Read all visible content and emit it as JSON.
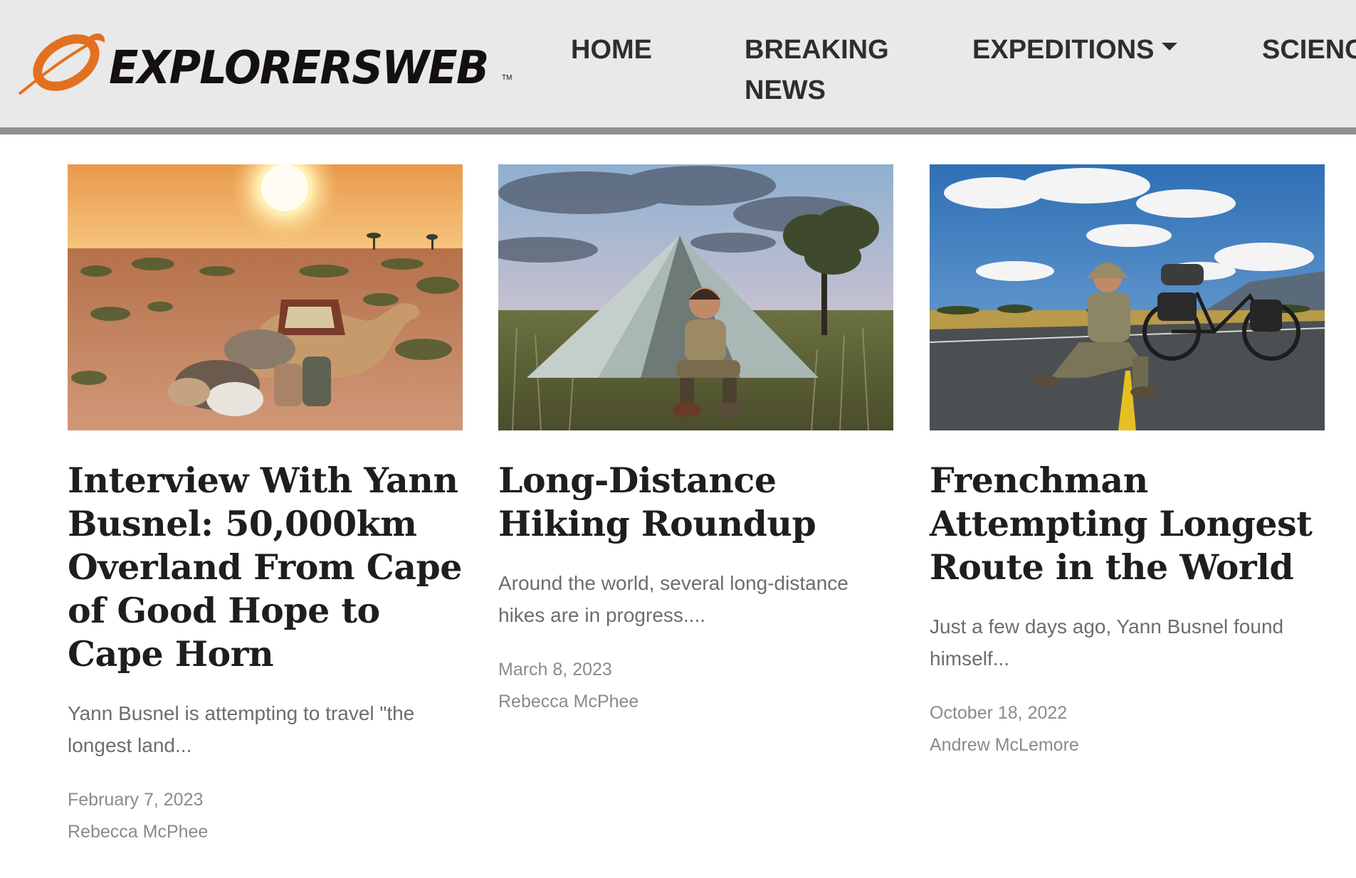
{
  "header": {
    "logo_text": "EXPLORERSWEB",
    "logo_tm": "TM",
    "nav": [
      {
        "label": "HOME"
      },
      {
        "label": "BREAKING NEWS"
      },
      {
        "label": "EXPEDITIONS"
      },
      {
        "label": "SCIENC"
      }
    ]
  },
  "articles": [
    {
      "image": "camel-in-desert-at-sunset",
      "title": "Interview With Yann Busnel: 50,000km Overland From Cape of Good Hope to Cape Horn",
      "excerpt": "Yann Busnel is attempting to travel \"the longest land...",
      "date": "February 7, 2023",
      "author": "Rebecca McPhee"
    },
    {
      "image": "hiker-sitting-in-tent",
      "title": "Long-Distance Hiking Roundup",
      "excerpt": "Around the world, several long-distance hikes are in progress....",
      "date": "March 8, 2023",
      "author": "Rebecca McPhee"
    },
    {
      "image": "cyclist-sitting-on-road",
      "title": "Frenchman Attempting Longest Route in the World",
      "excerpt": "Just a few days ago, Yann Busnel found himself...",
      "date": "October 18, 2022",
      "author": "Andrew McLemore"
    }
  ],
  "colors": {
    "header_bg": "#e9e9e9",
    "header_border": "#8f8f8f",
    "logo_orange": "#e3701e",
    "title_text": "#1e1e1e",
    "meta_text": "#8a8a8a"
  }
}
